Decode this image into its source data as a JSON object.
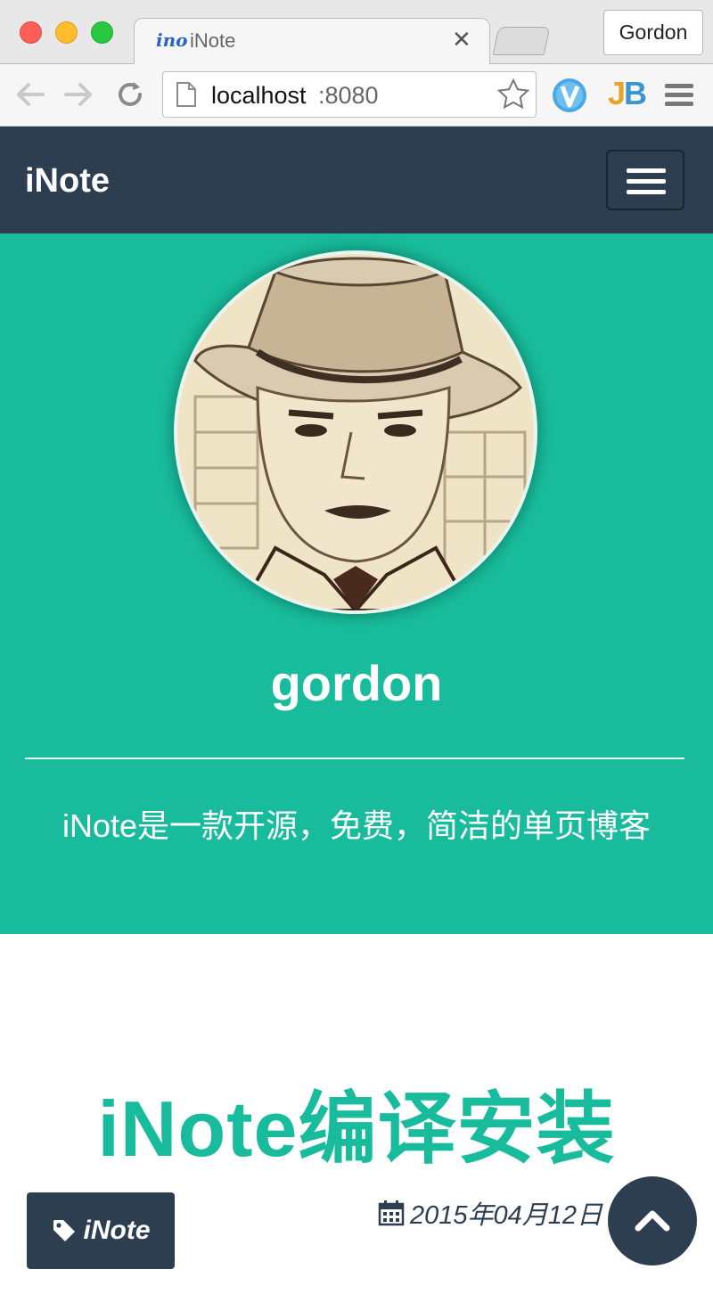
{
  "browser": {
    "tab_title": "iNote",
    "tab_favicon_text": "ino",
    "profile_name": "Gordon",
    "address_host": "localhost",
    "address_port": ":8080",
    "extensions": [
      "v-extension-icon",
      "jb-extension-icon"
    ],
    "extension_jb_text": "JB"
  },
  "navbar": {
    "brand": "iNote"
  },
  "header": {
    "username": "gordon",
    "tagline": "iNote是一款开源，免费，简洁的单页博客"
  },
  "post": {
    "title": "iNote编译安装",
    "tag": "iNote",
    "date": "2015年04月12日"
  },
  "colors": {
    "primary": "#2c3e50",
    "accent": "#18bc9c"
  }
}
